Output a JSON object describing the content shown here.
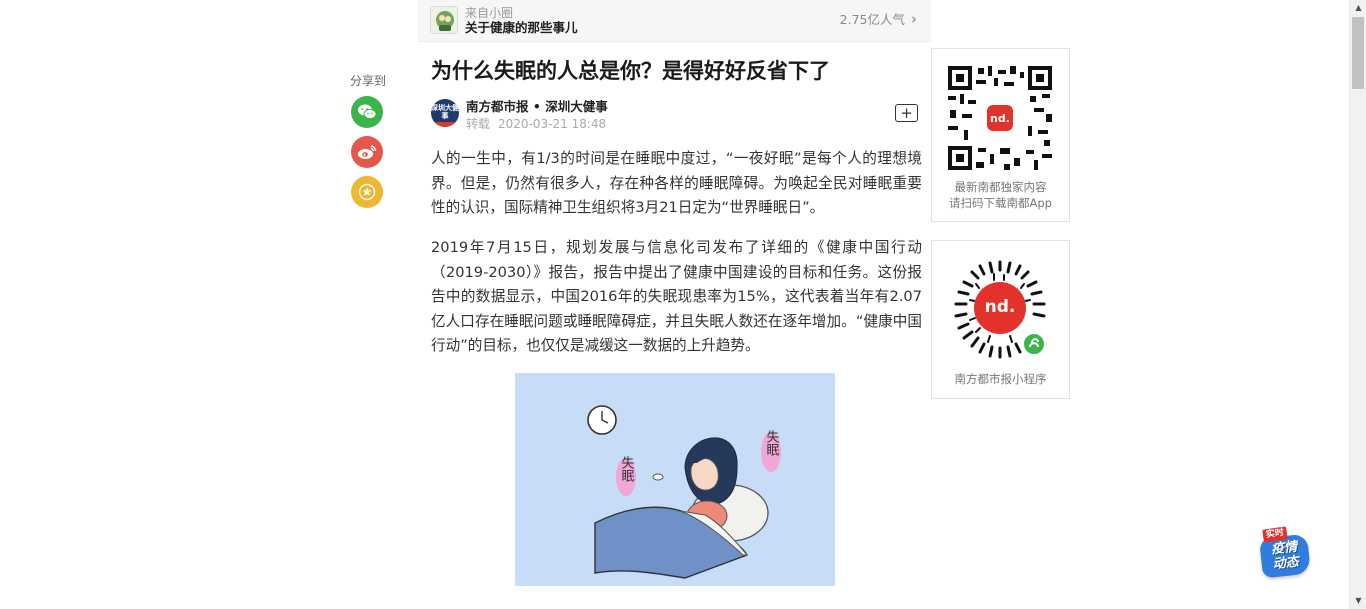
{
  "source": {
    "from_label": "来自小圈",
    "name": "关于健康的那些事儿",
    "popularity": "2.75亿人气"
  },
  "share": {
    "label": "分享到"
  },
  "article": {
    "title": "为什么失眠的人总是你？是得好好反省下了",
    "author": "南方都市报 • 深圳大健事",
    "logo_text": "深圳大健事",
    "repost_label": "转载",
    "datetime": "2020-03-21 18:48",
    "follow_label": "+",
    "paragraphs": [
      "人的一生中，有1/3的时间是在睡眠中度过，“一夜好眠”是每个人的理想境界。但是，仍然有很多人，存在种各样的睡眠障碍。为唤起全民对睡眠重要性的认识，国际精神卫生组织将3月21日定为“世界睡眠日”。",
      "2019年7月15日，规划发展与信息化司发布了详细的《健康中国行动（2019-2030）》报告，报告中提出了健康中国建设的目标和任务。这份报告中的数据显示，中国2016年的失眠现患率为15%，这代表着当年有2.07亿人口存在睡眠问题或睡眠障碍症，并且失眠人数还在逐年增加。“健康中国行动”的目标，也仅仅是减缓这一数据的上升趋势。"
    ],
    "illustration_labels": [
      "失眠",
      "失眠"
    ]
  },
  "sidebar": {
    "qr_app_caption_line1": "最新南都独家内容",
    "qr_app_caption_line2": "请扫码下载南都App",
    "qr_mini_caption": "南方都市报小程序",
    "logo_text": "nd."
  },
  "float_badge": {
    "tag": "实时",
    "text_line1": "疫情",
    "text_line2": "动态"
  },
  "colors": {
    "wechat": "#3bb54a",
    "weibo": "#e5574b",
    "favorite": "#efb630",
    "brand_red": "#e3322b",
    "badge_blue": "#2f7ddc"
  }
}
